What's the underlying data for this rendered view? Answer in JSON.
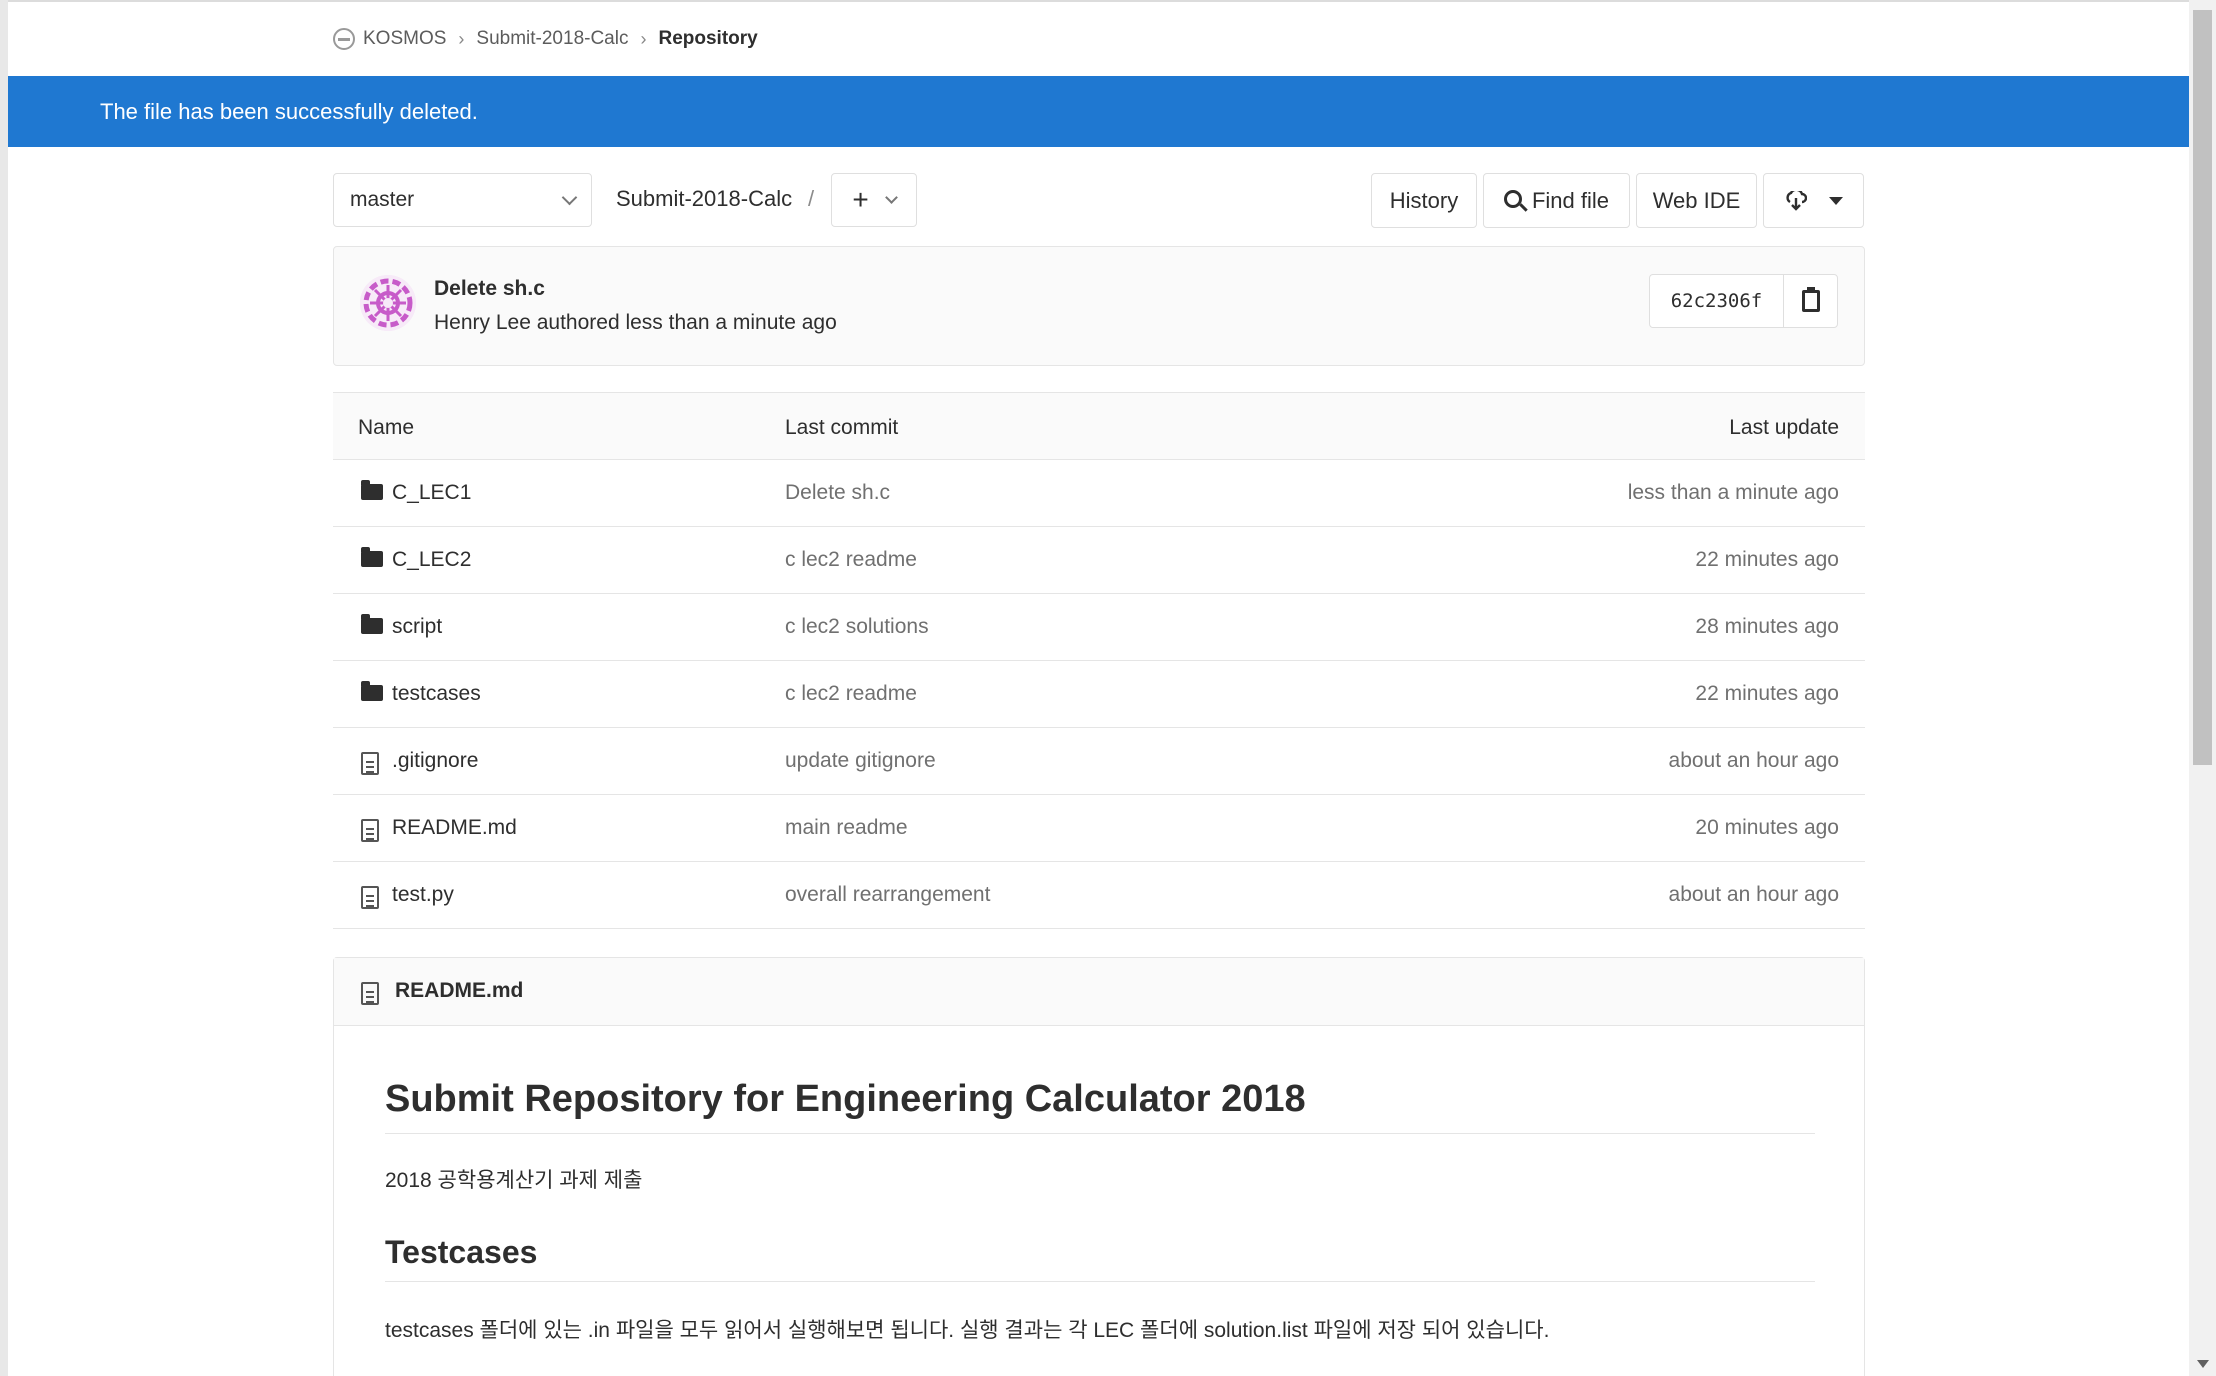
{
  "breadcrumb": {
    "group": "KOSMOS",
    "project": "Submit-2018-Calc",
    "current": "Repository"
  },
  "flash": {
    "message": "The file has been successfully deleted."
  },
  "toolbar": {
    "branch": "master",
    "path": "Submit-2018-Calc",
    "path_separator": "/",
    "add_label": "+",
    "history_label": "History",
    "find_file_label": "Find file",
    "web_ide_label": "Web IDE"
  },
  "last_commit": {
    "title": "Delete sh.c",
    "meta": "Henry Lee authored less than a minute ago",
    "sha": "62c2306f"
  },
  "tree": {
    "headers": {
      "name": "Name",
      "last_commit": "Last commit",
      "last_update": "Last update"
    },
    "rows": [
      {
        "type": "folder",
        "name": "C_LEC1",
        "commit": "Delete sh.c",
        "updated": "less than a minute ago"
      },
      {
        "type": "folder",
        "name": "C_LEC2",
        "commit": "c lec2 readme",
        "updated": "22 minutes ago"
      },
      {
        "type": "folder",
        "name": "script",
        "commit": "c lec2 solutions",
        "updated": "28 minutes ago"
      },
      {
        "type": "folder",
        "name": "testcases",
        "commit": "c lec2 readme",
        "updated": "22 minutes ago"
      },
      {
        "type": "file",
        "name": ".gitignore",
        "commit": "update gitignore",
        "updated": "about an hour ago"
      },
      {
        "type": "file",
        "name": "README.md",
        "commit": "main readme",
        "updated": "20 minutes ago"
      },
      {
        "type": "file",
        "name": "test.py",
        "commit": "overall rearrangement",
        "updated": "about an hour ago"
      }
    ]
  },
  "readme": {
    "filename": "README.md",
    "h1": "Submit Repository for Engineering Calculator 2018",
    "p1": "2018 공학용계산기 과제 제출",
    "h2": "Testcases",
    "p2": "testcases 폴더에 있는 .in 파일을 모두 읽어서 실행해보면 됩니다. 실행 결과는 각 LEC 폴더에 solution.list 파일에 저장 되어 있습니다."
  },
  "colors": {
    "flash_bg": "#1f78d1",
    "avatar_accent": "#c75bc9"
  }
}
